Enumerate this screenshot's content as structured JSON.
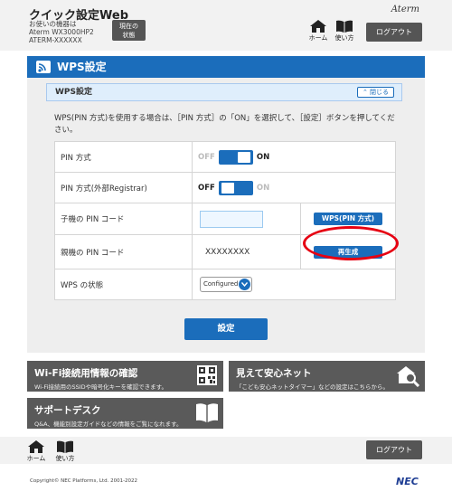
{
  "header": {
    "app_title": "クイック設定Web",
    "device_label": "お使いの機器は",
    "device_model": "Aterm WX3000HP2",
    "device_name": "ATERM-XXXXXX",
    "status_button": [
      "現在の",
      "状態"
    ],
    "brand": "Aterm",
    "home_label": "ホーム",
    "howto_label": "使い方",
    "logout_label": "ログアウト"
  },
  "panel": {
    "title": "WPS設定",
    "section_title": "WPS設定",
    "close_label": "閉じる",
    "description": "WPS(PIN 方式)を使用する場合は、［PIN 方式］の「ON」を選択して、［設定］ボタンを押してください。"
  },
  "table": {
    "rows": [
      {
        "label": "PIN 方式",
        "off": "OFF",
        "on": "ON",
        "state": "ON"
      },
      {
        "label": "PIN 方式(外部Registrar)",
        "off": "OFF",
        "on": "ON",
        "state": "OFF"
      },
      {
        "label": "子機の PIN コード",
        "input_value": "",
        "button": "WPS(PIN 方式)"
      },
      {
        "label": "親機の PIN コード",
        "value": "XXXXXXXX",
        "button": "再生成"
      },
      {
        "label": "WPS の状態",
        "select_value": "Configured"
      }
    ]
  },
  "set_button": "設定",
  "tiles": [
    {
      "title": "Wi-Fi接続用情報の確認",
      "subtitle": "Wi-Fi接続用のSSIDや暗号化キーを確認できます。",
      "icon": "qr-code-icon"
    },
    {
      "title": "見えて安心ネット",
      "subtitle": "「こども安心ネットタイマー」などの設定はこちらから。",
      "icon": "house-search-icon"
    },
    {
      "title": "サポートデスク",
      "subtitle": "Q&A、機能別設定ガイドなどの情報をご覧になれます。",
      "icon": "book-icon"
    }
  ],
  "footer": {
    "home_label": "ホーム",
    "howto_label": "使い方",
    "logout_label": "ログアウト",
    "copyright": "Copyright© NEC Platforms, Ltd. 2001-2022",
    "logo": "NEC"
  },
  "colors": {
    "accent": "#1b6dbb",
    "highlight": "#e60012",
    "tile": "#5a5a5a"
  }
}
